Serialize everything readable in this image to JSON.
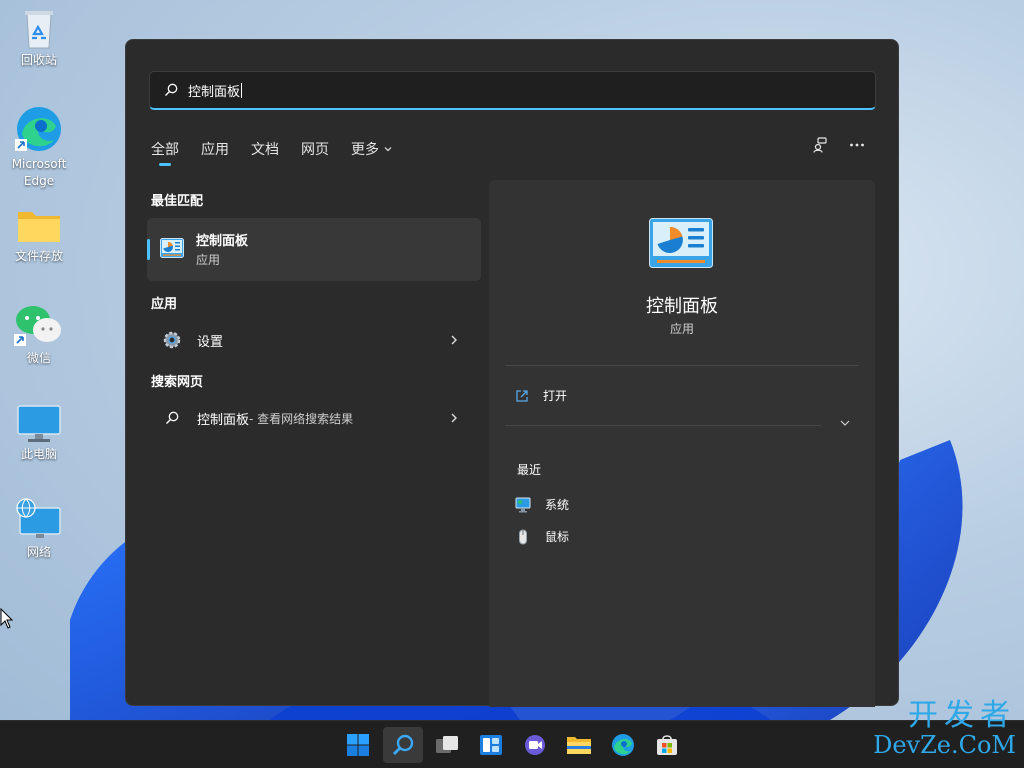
{
  "desktop": {
    "icons": [
      {
        "label": "回收站"
      },
      {
        "label": "Microsoft Edge"
      },
      {
        "label": "文件存放"
      },
      {
        "label": "微信"
      },
      {
        "label": "此电脑"
      },
      {
        "label": "网络"
      }
    ]
  },
  "start_menu": {
    "search": {
      "value": "控制面板"
    },
    "tabs": [
      {
        "label": "全部"
      },
      {
        "label": "应用"
      },
      {
        "label": "文档"
      },
      {
        "label": "网页"
      },
      {
        "label": "更多"
      }
    ],
    "best_match": {
      "heading": "最佳匹配",
      "name": "控制面板",
      "type": "应用"
    },
    "apps": {
      "heading": "应用",
      "items": [
        {
          "label": "设置"
        }
      ]
    },
    "web": {
      "heading": "搜索网页",
      "query": "控制面板",
      "suffix": " - 查看网络搜索结果"
    },
    "preview": {
      "title": "控制面板",
      "type": "应用",
      "open_label": "打开",
      "recent_heading": "最近",
      "recent": [
        {
          "label": "系统"
        },
        {
          "label": "鼠标"
        }
      ]
    }
  },
  "watermark": {
    "cn": "开发者",
    "en": "DevZe.CoM"
  },
  "colors": {
    "accent": "#4cc2ff",
    "menu_bg": "#2b2b2b",
    "preview_bg": "#333333",
    "taskbar_bg": "#202020"
  }
}
